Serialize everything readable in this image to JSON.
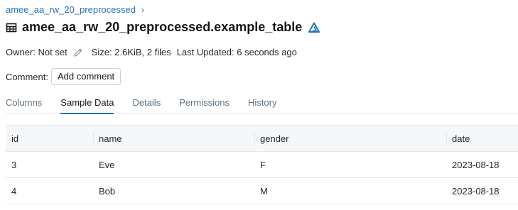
{
  "breadcrumb": {
    "schema": "amee_aa_rw_20_preprocessed",
    "separator": "›"
  },
  "header": {
    "title": "amee_aa_rw_20_preprocessed.example_table"
  },
  "meta": {
    "owner": "Owner: Not set",
    "size": "Size: 2.6KiB, 2 files",
    "updated": "Last Updated: 6 seconds ago"
  },
  "comment": {
    "label": "Comment:",
    "button": "Add comment"
  },
  "tabs": [
    {
      "label": "Columns",
      "active": false
    },
    {
      "label": "Sample Data",
      "active": true
    },
    {
      "label": "Details",
      "active": false
    },
    {
      "label": "Permissions",
      "active": false
    },
    {
      "label": "History",
      "active": false
    }
  ],
  "table": {
    "columns": [
      "id",
      "name",
      "gender",
      "date"
    ],
    "rows": [
      [
        "3",
        "Eve",
        "F",
        "2023-08-18"
      ],
      [
        "4",
        "Bob",
        "M",
        "2023-08-18"
      ]
    ]
  },
  "colors": {
    "accent": "#2272b4",
    "link": "#2272b4",
    "header_bg": "#f5f7f9",
    "border": "#e4e8ec"
  },
  "icons": {
    "table": "table-icon",
    "delta": "delta-icon",
    "edit": "pencil-icon",
    "breadcrumb": "chevron-right-icon"
  }
}
